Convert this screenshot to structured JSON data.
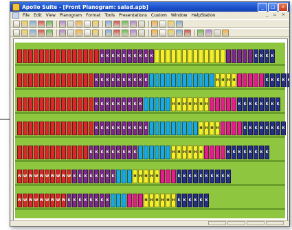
{
  "window": {
    "title": "Apollo Suite - [Front Planogram: salad.apb]",
    "controls": {
      "minimize": "_",
      "maximize": "□",
      "close": "×"
    }
  },
  "menu": {
    "items": [
      "File",
      "Edit",
      "View",
      "Planogram",
      "Format",
      "Tools",
      "Presentations",
      "Custom",
      "Window",
      "HelpStation"
    ],
    "mdi_controls": "_ ▫ ×"
  },
  "toolbar_icons": {
    "row1": [
      "new-icon",
      "open-icon",
      "color-icon",
      "grid-icon",
      "save-icon",
      "print-icon",
      "cut-icon",
      "copy-icon",
      "paste-icon",
      "chart-icon",
      "table-icon",
      "report-icon",
      "shelf-icon",
      "fixture-icon",
      "product-icon",
      "image-icon",
      "view-icon",
      "help-icon",
      "pointer-help-icon"
    ],
    "row2": [
      "arrow-icon",
      "select-icon",
      "zoom-in-icon",
      "zoom-out-icon",
      "magnify-icon",
      "line-icon",
      "rect-icon",
      "fill-icon",
      "shelf-tool-icon",
      "peg-icon",
      "bin-icon",
      "bar-icon",
      "box-icon",
      "text-icon",
      "align-left-icon",
      "align-center-icon",
      "align-right-icon",
      "distribute-icon",
      "space-icon",
      "flip-icon",
      "rotate-icon",
      "group-icon",
      "ungroup-icon",
      "lock-icon"
    ]
  },
  "colors": {
    "red": "#d8282e",
    "magenta": "#e0208a",
    "purple": "#7b2a8c",
    "cyan": "#1ba8e0",
    "yellow": "#f6ef2e",
    "navy": "#2a2f86",
    "background": "#8ec63f"
  },
  "shelves": [
    {
      "segments": [
        {
          "color": "red",
          "count": 15,
          "label": ""
        },
        {
          "color": "purple",
          "count": 10,
          "label": "K"
        },
        {
          "color": "yellow",
          "count": 13,
          "label": ""
        },
        {
          "color": "purple",
          "count": 5,
          "label": ""
        },
        {
          "color": "navy",
          "count": 4,
          "label": "K"
        }
      ]
    },
    {
      "segments": [
        {
          "color": "red",
          "count": 14,
          "label": ""
        },
        {
          "color": "purple",
          "count": 10,
          "label": "K"
        },
        {
          "color": "cyan",
          "count": 12,
          "label": ""
        },
        {
          "color": "yellow",
          "count": 4,
          "label": "H"
        },
        {
          "color": "magenta",
          "count": 5,
          "label": ""
        },
        {
          "color": "navy",
          "count": 5,
          "label": "K"
        }
      ]
    },
    {
      "segments": [
        {
          "color": "red",
          "count": 14,
          "label": ""
        },
        {
          "color": "purple",
          "count": 9,
          "label": "K"
        },
        {
          "color": "cyan",
          "count": 5,
          "label": ""
        },
        {
          "color": "yellow",
          "count": 7,
          "label": "H"
        },
        {
          "color": "magenta",
          "count": 5,
          "label": ""
        },
        {
          "color": "navy",
          "count": 8,
          "label": "K"
        }
      ]
    },
    {
      "segments": [
        {
          "color": "red",
          "count": 14,
          "label": ""
        },
        {
          "color": "purple",
          "count": 10,
          "label": "K"
        },
        {
          "color": "cyan",
          "count": 9,
          "label": ""
        },
        {
          "color": "yellow",
          "count": 4,
          "label": "H"
        },
        {
          "color": "magenta",
          "count": 4,
          "label": ""
        },
        {
          "color": "navy",
          "count": 8,
          "label": "K"
        }
      ]
    },
    {
      "segments": [
        {
          "color": "red",
          "count": 13,
          "label": ""
        },
        {
          "color": "purple",
          "count": 9,
          "label": "K"
        },
        {
          "color": "cyan",
          "count": 6,
          "label": ""
        },
        {
          "color": "yellow",
          "count": 6,
          "label": "H"
        },
        {
          "color": "magenta",
          "count": 4,
          "label": ""
        },
        {
          "color": "navy",
          "count": 8,
          "label": "K"
        }
      ]
    },
    {
      "segments": [
        {
          "color": "red",
          "count": 10,
          "label": "W"
        },
        {
          "color": "purple",
          "count": 8,
          "label": "K"
        },
        {
          "color": "cyan",
          "count": 3,
          "label": ""
        },
        {
          "color": "yellow",
          "count": 5,
          "label": "H"
        },
        {
          "color": "magenta",
          "count": 3,
          "label": ""
        },
        {
          "color": "navy",
          "count": 10,
          "label": "K"
        }
      ]
    },
    {
      "segments": [
        {
          "color": "red",
          "count": 9,
          "label": "W"
        },
        {
          "color": "purple",
          "count": 8,
          "label": "K"
        },
        {
          "color": "cyan",
          "count": 3,
          "label": ""
        },
        {
          "color": "magenta",
          "count": 3,
          "label": ""
        },
        {
          "color": "yellow",
          "count": 6,
          "label": "H"
        },
        {
          "color": "navy",
          "count": 6,
          "label": "K"
        }
      ]
    }
  ],
  "status_panels": [
    "",
    "",
    "",
    ""
  ]
}
